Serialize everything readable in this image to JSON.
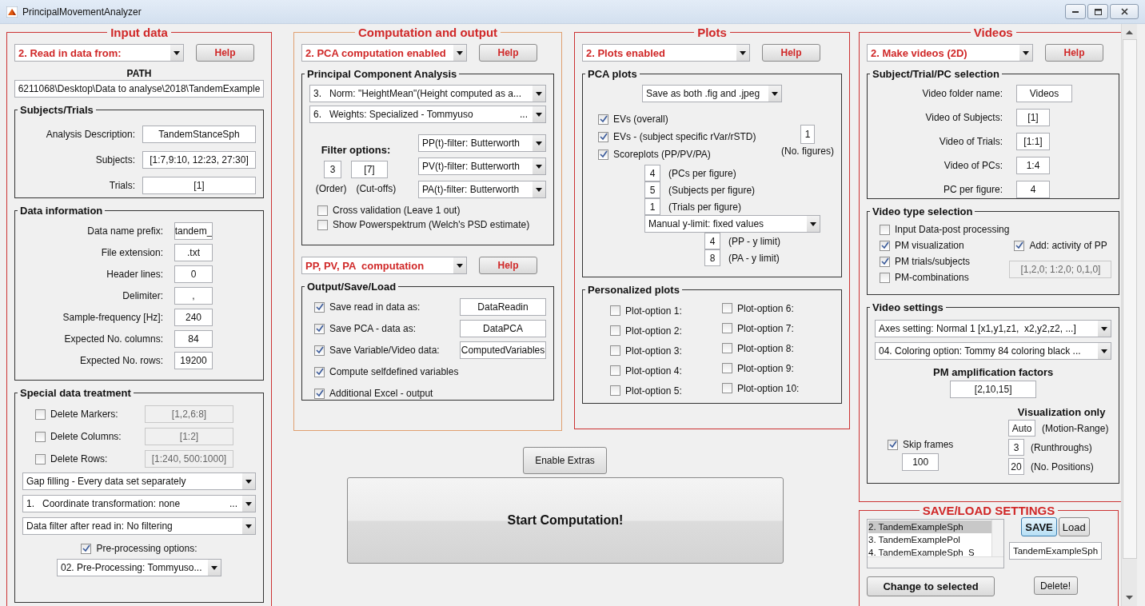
{
  "window": {
    "title": "PrincipalMovementAnalyzer"
  },
  "input_data": {
    "title": "Input data",
    "mode": "2. Read in data from:",
    "help": "Help",
    "path_label": "PATH",
    "path": "6211068\\Desktop\\Data to analyse\\2018\\TandemExample",
    "subjects_trials": {
      "title": "Subjects/Trials",
      "fields": [
        {
          "label": "Analysis Description:",
          "value": "TandemStanceSph"
        },
        {
          "label": "Subjects:",
          "value": "[1:7,9:10, 12:23, 27:30]"
        },
        {
          "label": "Trials:",
          "value": "[1]"
        }
      ]
    },
    "data_information": {
      "title": "Data information",
      "fields": [
        {
          "label": "Data name prefix:",
          "value": "tandem_"
        },
        {
          "label": "File extension:",
          "value": ".txt"
        },
        {
          "label": "Header lines:",
          "value": "0"
        },
        {
          "label": "Delimiter:",
          "value": ","
        },
        {
          "label": "Sample-frequency [Hz]:",
          "value": "240"
        },
        {
          "label": "Expected No. columns:",
          "value": "84"
        },
        {
          "label": "Expected No. rows:",
          "value": "19200"
        }
      ]
    },
    "special_data_treatment": {
      "title": "Special data treatment",
      "deletions": [
        {
          "label": "Delete Markers:",
          "checked": false,
          "value": "[1,2,6:8]"
        },
        {
          "label": "Delete Columns:",
          "checked": false,
          "value": "[1:2]"
        },
        {
          "label": "Delete Rows:",
          "checked": false,
          "value": "[1:240, 500:1000]"
        }
      ],
      "dropdowns": [
        {
          "text": "Gap filling - Every data set separately"
        },
        {
          "text": "1.   Coordinate transformation: none",
          "suffix": "..."
        },
        {
          "text": "Data filter after read in: No filtering"
        }
      ],
      "preprocessing": {
        "label": "Pre-processing options:",
        "checked": true,
        "dropdown": "02. Pre-Processing: Tommyuso..."
      }
    }
  },
  "computation": {
    "title": "Computation and output",
    "mode": "2. PCA computation enabled",
    "help": "Help",
    "pca": {
      "title": "Principal Component Analysis",
      "dropdowns": [
        {
          "text": "3.   Norm: \"HeightMean\"(Height computed as a..."
        },
        {
          "text": "6.   Weights: Specialized - Tommyuso",
          "suffix": "..."
        }
      ],
      "filter_label": "Filter options:",
      "order": "3",
      "cutoffs": "[7]",
      "order_label": "(Order)",
      "cutoffs_label": "(Cut-offs)",
      "filters": [
        "PP(t)-filter: Butterworth",
        "PV(t)-filter: Butterworth",
        "PA(t)-filter: Butterworth"
      ],
      "options": [
        {
          "label": "Cross validation (Leave 1 out)",
          "checked": false
        },
        {
          "label": "Show Powerspektrum (Welch's PSD estimate)",
          "checked": false
        }
      ]
    },
    "pp_mode": "PP, PV, PA  computation",
    "pp_help": "Help",
    "output": {
      "title": "Output/Save/Load",
      "rows": [
        {
          "label": "Save read in data as:",
          "checked": true,
          "value": "DataReadin"
        },
        {
          "label": "Save PCA - data as:",
          "checked": true,
          "value": "DataPCA"
        },
        {
          "label": "Save Variable/Video data:",
          "checked": true,
          "value": "ComputedVariables"
        },
        {
          "label": "Compute selfdefined variables",
          "checked": true
        },
        {
          "label": "Additional Excel - output",
          "checked": true
        }
      ]
    }
  },
  "plots": {
    "title": "Plots",
    "mode": "2. Plots enabled",
    "help": "Help",
    "pca_plots": {
      "title": "PCA plots",
      "save_format": "Save as both .fig and .jpeg",
      "checks": [
        {
          "label": "EVs (overall)",
          "checked": true
        },
        {
          "label": "EVs - (subject specific rVar/rSTD)",
          "checked": true
        },
        {
          "label": "Scoreplots (PP/PV/PA)",
          "checked": true
        }
      ],
      "no_figures": "1",
      "no_figures_label": "(No. figures)",
      "per_figure": [
        {
          "value": "4",
          "label": "(PCs per figure)"
        },
        {
          "value": "5",
          "label": "(Subjects per figure)"
        },
        {
          "value": "1",
          "label": "(Trials per figure)"
        }
      ],
      "ylimit_mode": "Manual y-limit: fixed values",
      "ylimits": [
        {
          "value": "4",
          "label": "(PP - y limit)"
        },
        {
          "value": "8",
          "label": "(PA - y limit)"
        }
      ]
    },
    "personalized": {
      "title": "Personalized plots",
      "options": [
        {
          "label": "Plot-option 1:",
          "checked": false
        },
        {
          "label": "Plot-option 2:",
          "checked": false
        },
        {
          "label": "Plot-option 3:",
          "checked": false
        },
        {
          "label": "Plot-option 4:",
          "checked": false
        },
        {
          "label": "Plot-option 5:",
          "checked": false
        },
        {
          "label": "Plot-option 6:",
          "checked": false
        },
        {
          "label": "Plot-option 7:",
          "checked": false
        },
        {
          "label": "Plot-option 8:",
          "checked": false
        },
        {
          "label": "Plot-option 9:",
          "checked": false
        },
        {
          "label": "Plot-option 10:",
          "checked": false
        }
      ]
    }
  },
  "enable_extras": "Enable Extras",
  "start": "Start Computation!",
  "videos": {
    "title": "Videos",
    "mode": "2. Make videos (2D)",
    "help": "Help",
    "selection": {
      "title": "Subject/Trial/PC selection",
      "fields": [
        {
          "label": "Video folder name:",
          "value": "Videos"
        },
        {
          "label": "Video of Subjects:",
          "value": "[1]"
        },
        {
          "label": "Video of Trials:",
          "value": "[1:1]"
        },
        {
          "label": "Video of PCs:",
          "value": "1:4"
        },
        {
          "label": "PC per figure:",
          "value": "4"
        }
      ]
    },
    "video_type": {
      "title": "Video type selection",
      "checks": [
        {
          "label": "Input Data-post processing",
          "checked": false
        },
        {
          "label": "PM visualization",
          "checked": true
        },
        {
          "label": "PM trials/subjects",
          "checked": true
        },
        {
          "label": "PM-combinations",
          "checked": false
        }
      ],
      "add_activity": {
        "label": "Add: activity of PP",
        "checked": true
      },
      "combinations": "[1,2,0; 1:2,0; 0,1,0]"
    },
    "settings": {
      "title": "Video settings",
      "dropdowns": [
        {
          "text": "Axes setting: Normal 1 [x1,y1,z1,  x2,y2,z2, ...]"
        },
        {
          "text": "04. Coloring option: Tommy 84 coloring black ..."
        }
      ],
      "amplification_label": "PM amplification factors",
      "amplification": "[2,10,15]",
      "visualization_label": "Visualization only",
      "skip_frames": {
        "label": "Skip frames",
        "checked": true,
        "value": "100"
      },
      "visualization": [
        {
          "value": "Auto",
          "label": "(Motion-Range)"
        },
        {
          "value": "3",
          "label": "(Runthroughs)"
        },
        {
          "value": "20",
          "label": "(No. Positions)"
        }
      ]
    }
  },
  "save_load": {
    "title": "SAVE/LOAD SETTINGS",
    "items": [
      {
        "label": "2. TandemExampleSph",
        "selected": true
      },
      {
        "label": "3. TandemExamplePol",
        "selected": false
      },
      {
        "label": "4. TandemExampleSph_S",
        "selected": false
      }
    ],
    "buttons": [
      {
        "label": "SAVE",
        "focused": true
      },
      {
        "label": "Load",
        "focused": false
      }
    ],
    "name": "TandemExampleSph",
    "change": "Change to selected",
    "delete": "Delete!"
  }
}
